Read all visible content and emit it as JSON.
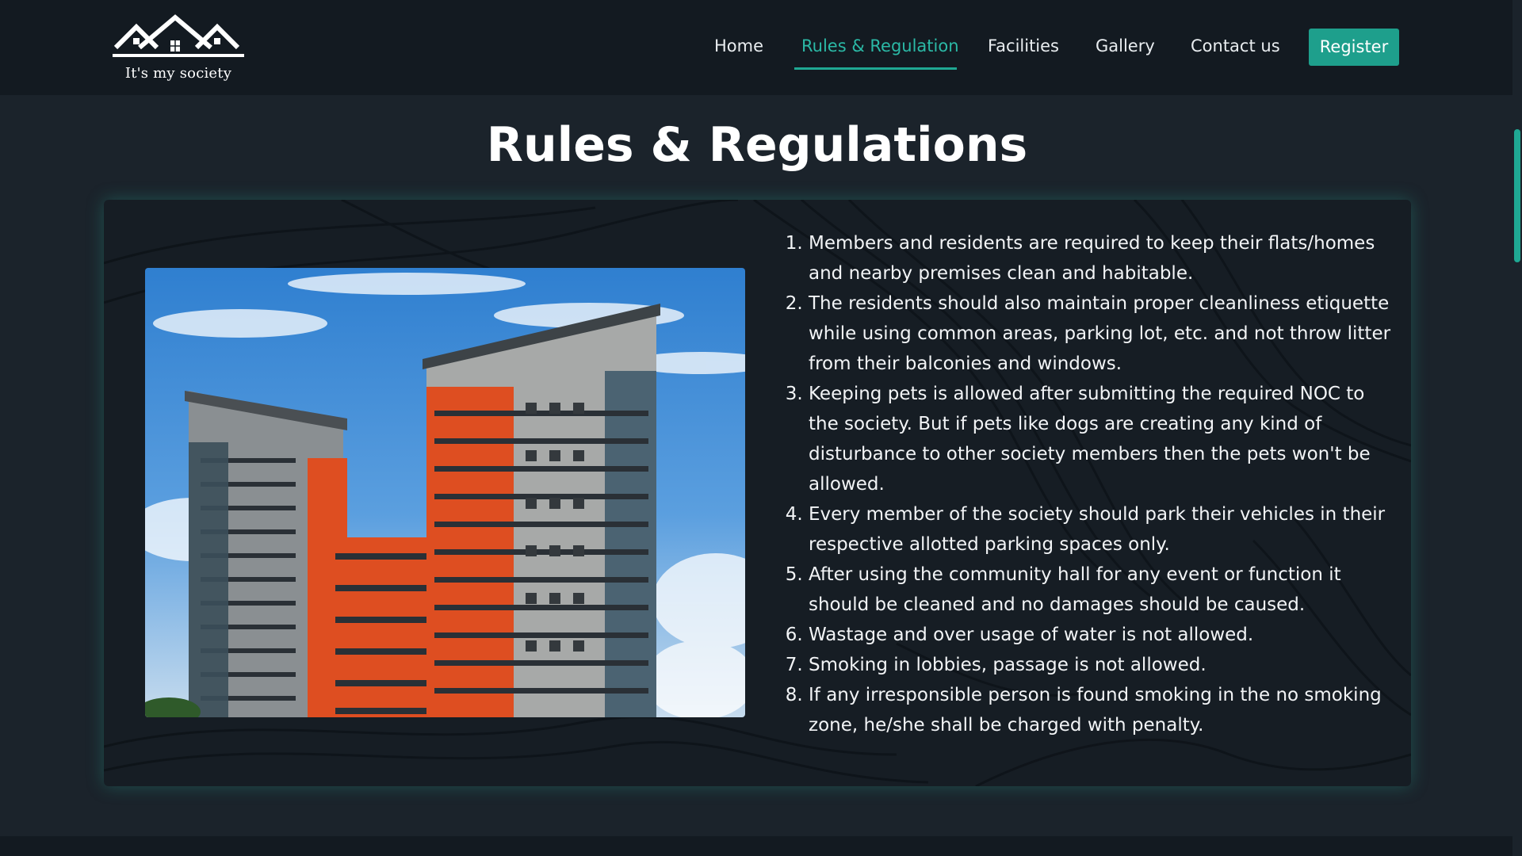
{
  "brand": {
    "tagline": "It's my society",
    "logo_icon": "houses-roof-logo"
  },
  "nav": {
    "items": [
      {
        "label": "Home",
        "active": false
      },
      {
        "label": "Rules & Regulation",
        "active": true
      },
      {
        "label": "Facilities",
        "active": false
      },
      {
        "label": "Gallery",
        "active": false
      },
      {
        "label": "Contact us",
        "active": false
      }
    ],
    "register_label": "Register"
  },
  "page": {
    "title": "Rules & Regulations"
  },
  "rules": [
    "Members and residents are required to keep their flats/homes and nearby premises clean and habitable.",
    "The residents should also maintain proper cleanliness etiquette while using common areas, parking lot, etc. and not throw litter from their balconies and windows.",
    "Keeping pets is allowed after submitting the required NOC to the society. But if pets like dogs are creating any kind of disturbance to other society members then the pets won't be allowed.",
    "Every member of the society should park their vehicles in their respective allotted parking spaces only.",
    "After using the community hall for any event or function it should be cleaned and no damages should be caused.",
    "Wastage and over usage of water is not allowed.",
    "Smoking in lobbies, passage is not allowed.",
    "If any irresponsible person is found smoking in the no smoking zone, he/she shall be charged with penalty."
  ],
  "colors": {
    "accent": "#1fa893",
    "nav_bg": "#131a21",
    "page_bg": "#1b232b",
    "card_bg": "#161d24"
  }
}
